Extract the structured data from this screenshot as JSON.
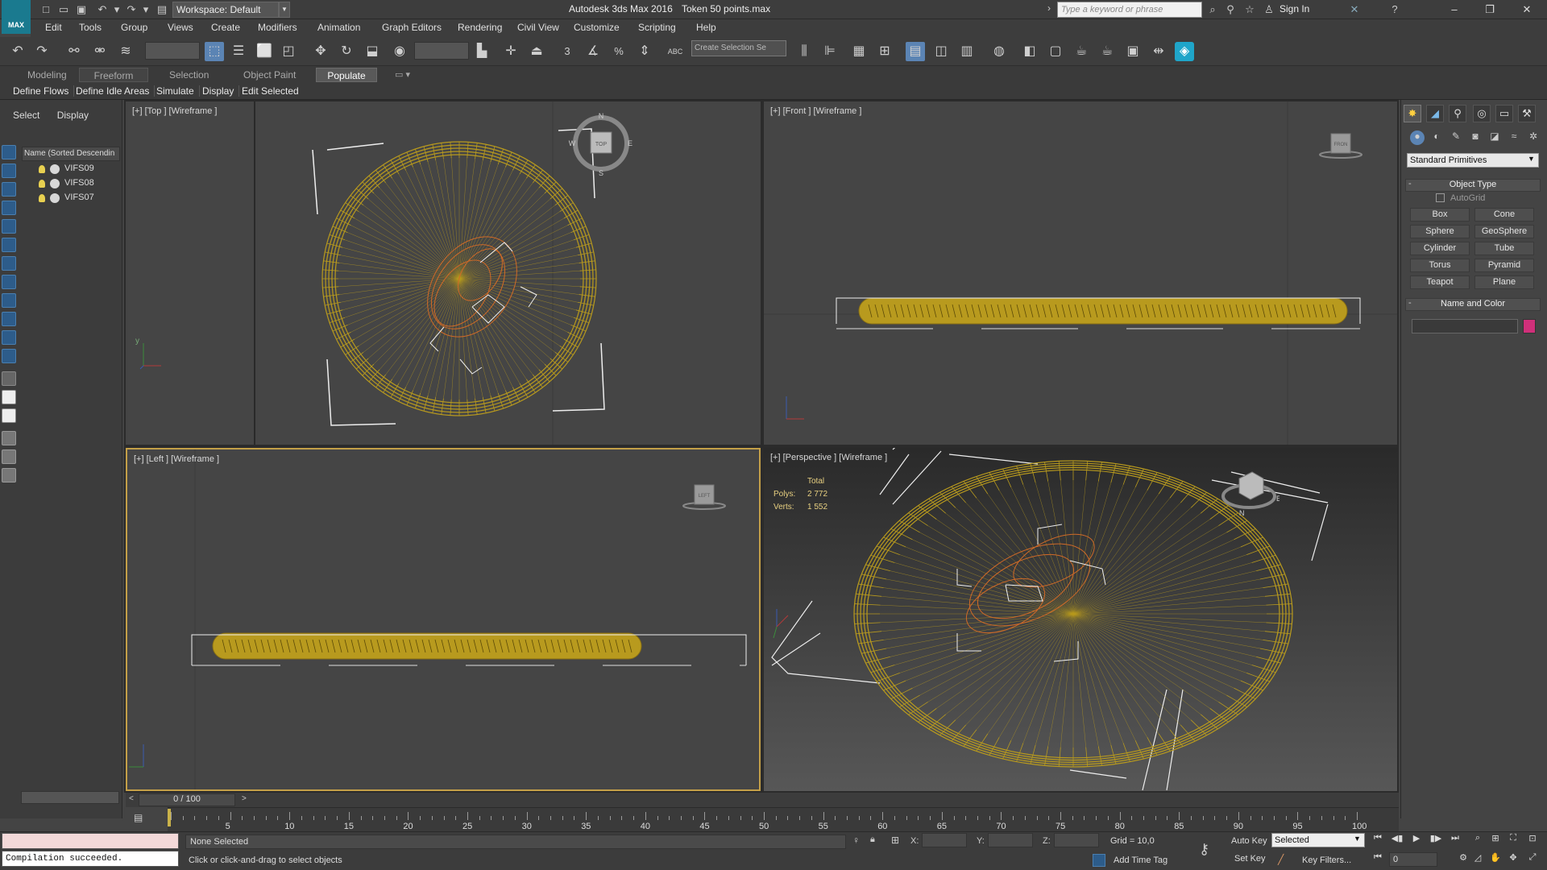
{
  "titlebar": {
    "workspace": "Workspace: Default",
    "app_title": "Autodesk 3ds Max 2016",
    "file_title": "Token 50 points.max",
    "search_placeholder": "Type a keyword or phrase",
    "sign_in": "Sign In",
    "logo_text": "MAX"
  },
  "menus": [
    "Edit",
    "Tools",
    "Group",
    "Views",
    "Create",
    "Modifiers",
    "Animation",
    "Graph Editors",
    "Rendering",
    "Civil View",
    "Customize",
    "Scripting",
    "Help"
  ],
  "toolbar": {
    "selection_set_placeholder": "Create Selection Se",
    "snap_3": "3",
    "percent": "%",
    "abc": "ABC"
  },
  "ribbon": {
    "tabs": [
      "Modeling",
      "Freeform",
      "Selection",
      "Object Paint",
      "Populate"
    ],
    "active_tab": "Populate",
    "buttons": [
      "Define Flows",
      "Define Idle Areas",
      "Simulate",
      "Display",
      "Edit Selected"
    ]
  },
  "scene_explorer": {
    "tabs": [
      "Select",
      "Display"
    ],
    "header": "Name (Sorted Descendin",
    "items": [
      "VIFS09",
      "VIFS08",
      "VIFS07"
    ]
  },
  "viewports": {
    "top": {
      "label": "[+] [Top ] [Wireframe ]",
      "cube": "TOP",
      "compass": [
        "N",
        "S",
        "W",
        "E"
      ]
    },
    "front": {
      "label": "[+] [Front ] [Wireframe ]",
      "cube": "FRON"
    },
    "left": {
      "label": "[+] [Left ] [Wireframe ]",
      "cube": "LEFT"
    },
    "perspective": {
      "label": "[+] [Perspective ] [Wireframe ]",
      "stats_total": "Total",
      "polys_label": "Polys:",
      "polys": "2 772",
      "verts_label": "Verts:",
      "verts": "1 552",
      "compass": [
        "N",
        "E"
      ]
    }
  },
  "command_panel": {
    "category": "Standard Primitives",
    "object_type": "Object Type",
    "autogrid": "AutoGrid",
    "primitives": [
      "Box",
      "Cone",
      "Sphere",
      "GeoSphere",
      "Cylinder",
      "Tube",
      "Torus",
      "Pyramid",
      "Teapot",
      "Plane"
    ],
    "name_and_color": "Name and Color",
    "color": "#d0307a"
  },
  "timeline": {
    "frame_readout": "0 / 100",
    "ticks": [
      "5",
      "10",
      "15",
      "20",
      "25",
      "30",
      "35",
      "40",
      "45",
      "50",
      "55",
      "60",
      "65",
      "70",
      "75",
      "80",
      "85",
      "90",
      "95",
      "100"
    ]
  },
  "statusbar": {
    "maxscript_output": "Compilation succeeded.",
    "selection_status": "None Selected",
    "prompt": "Click or click-and-drag to select objects",
    "x_label": "X:",
    "y_label": "Y:",
    "z_label": "Z:",
    "grid": "Grid = 10,0",
    "add_time_tag": "Add Time Tag",
    "auto_key": "Auto Key",
    "set_key": "Set Key",
    "key_mode": "Selected",
    "key_filters": "Key Filters...",
    "current_frame": "0"
  },
  "colors": {
    "wire_gold": "#b89a1e",
    "wire_orange": "#d06a28",
    "active_border": "#c4a048"
  }
}
